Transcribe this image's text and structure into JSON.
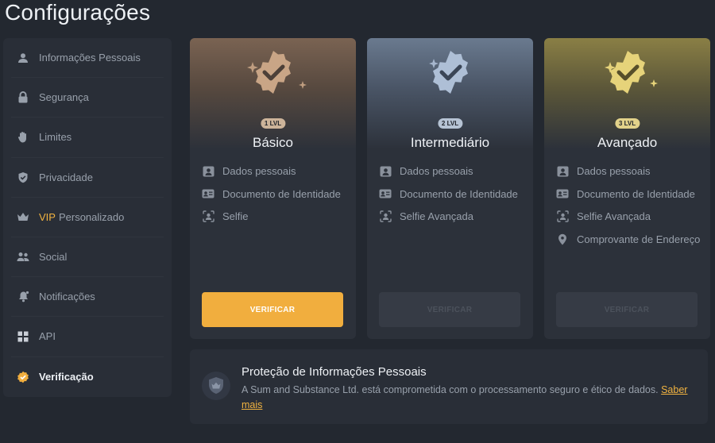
{
  "page_title": "Configurações",
  "sidebar": {
    "items": [
      {
        "label": "Informações Pessoais",
        "icon": "user-icon"
      },
      {
        "label": "Segurança",
        "icon": "lock-icon"
      },
      {
        "label": "Limites",
        "icon": "hand-icon"
      },
      {
        "label": "Privacidade",
        "icon": "shield-check-icon"
      },
      {
        "prefix": "VIP",
        "label": "Personalizado",
        "icon": "crown-icon"
      },
      {
        "label": "Social",
        "icon": "users-icon"
      },
      {
        "label": "Notificações",
        "icon": "megaphone-icon"
      },
      {
        "label": "API",
        "icon": "grid-icon"
      },
      {
        "label": "Verificação",
        "icon": "verified-badge-icon",
        "active": true
      }
    ]
  },
  "levels": [
    {
      "lvl": "1 LVL",
      "title": "Básico",
      "features": [
        {
          "label": "Dados pessoais",
          "icon": "person-card-icon"
        },
        {
          "label": "Documento de Identidade",
          "icon": "id-card-icon"
        },
        {
          "label": "Selfie",
          "icon": "face-scan-icon"
        }
      ],
      "button": "VERIFICAR",
      "button_state": "enabled",
      "badge_color": "#c9a586"
    },
    {
      "lvl": "2 LVL",
      "title": "Intermediário",
      "features": [
        {
          "label": "Dados pessoais",
          "icon": "person-card-icon"
        },
        {
          "label": "Documento de Identidade",
          "icon": "id-card-icon"
        },
        {
          "label": "Selfie Avançada",
          "icon": "face-scan-icon"
        }
      ],
      "button": "VERIFICAR",
      "button_state": "disabled",
      "badge_color": "#aebfd6"
    },
    {
      "lvl": "3 LVL",
      "title": "Avançado",
      "features": [
        {
          "label": "Dados pessoais",
          "icon": "person-card-icon"
        },
        {
          "label": "Documento de Identidade",
          "icon": "id-card-icon"
        },
        {
          "label": "Selfie Avançada",
          "icon": "face-scan-icon"
        },
        {
          "label": "Comprovante de Endereço",
          "icon": "location-pin-icon"
        }
      ],
      "button": "VERIFICAR",
      "button_state": "disabled",
      "badge_color": "#e6d37a"
    }
  ],
  "protection": {
    "title": "Proteção de Informações Pessoais",
    "description": "A Sum and Substance Ltd. está comprometida com o processamento seguro e ético de dados.",
    "link": "Saber mais"
  },
  "colors": {
    "background": "#232830",
    "panel": "#292e37",
    "accent": "#f1ae3e"
  }
}
